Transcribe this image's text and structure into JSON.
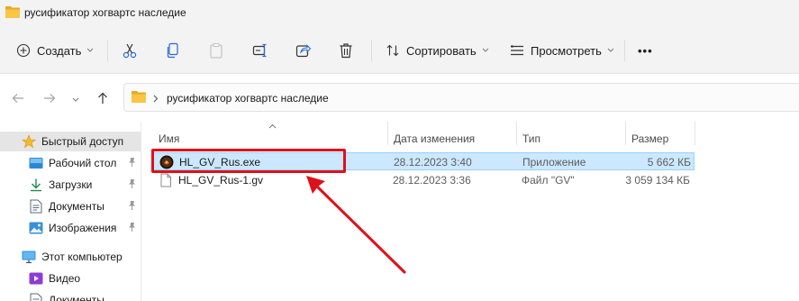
{
  "window": {
    "title": "русификатор хогвартс наследие"
  },
  "toolbar": {
    "create_label": "Создать",
    "sort_label": "Сортировать",
    "view_label": "Просмотреть",
    "more_label": "•••"
  },
  "address": {
    "path": "русификатор хогвартс наследие"
  },
  "sidebar": {
    "items": [
      {
        "label": "Быстрый доступ",
        "icon": "star-icon",
        "selected": true
      },
      {
        "label": "Рабочий стол",
        "icon": "desktop-icon",
        "pinned": true
      },
      {
        "label": "Загрузки",
        "icon": "download-icon",
        "pinned": true
      },
      {
        "label": "Документы",
        "icon": "documents-icon",
        "pinned": true
      },
      {
        "label": "Изображения",
        "icon": "images-icon",
        "pinned": true
      },
      {
        "label": "Этот компьютер",
        "icon": "computer-icon"
      },
      {
        "label": "Видео",
        "icon": "video-icon"
      },
      {
        "label": "Документы",
        "icon": "documents-icon"
      }
    ]
  },
  "columns": {
    "name": "Имя",
    "date": "Дата изменения",
    "type": "Тип",
    "size": "Размер"
  },
  "files": [
    {
      "name": "HL_GV_Rus.exe",
      "date": "28.12.2023 3:40",
      "type": "Приложение",
      "size": "5 662 КБ",
      "icon": "exe-app-icon",
      "selected": true
    },
    {
      "name": "HL_GV_Rus-1.gv",
      "date": "28.12.2023 3:36",
      "type": "Файл \"GV\"",
      "size": "3 059 134 КБ",
      "icon": "blank-file-icon",
      "selected": false
    }
  ],
  "colors": {
    "selection_bg": "#cce8ff",
    "selection_border": "#99d1ff",
    "annotation_red": "#e0101a",
    "folder_yellow": "#f8c545"
  }
}
